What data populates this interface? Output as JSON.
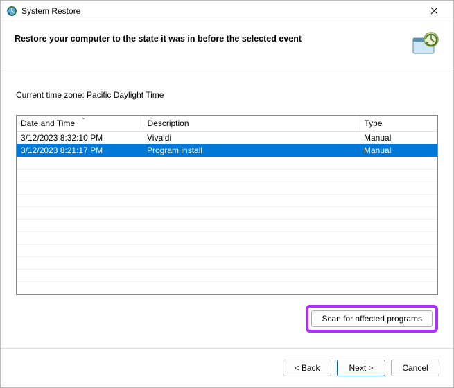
{
  "title": "System Restore",
  "heading": "Restore your computer to the state it was in before the selected event",
  "timezone_label": "Current time zone: Pacific Daylight Time",
  "columns": {
    "date": "Date and Time",
    "desc": "Description",
    "type": "Type"
  },
  "rows": [
    {
      "date": "3/12/2023 8:32:10 PM",
      "desc": "Vivaldi",
      "type": "Manual",
      "selected": false
    },
    {
      "date": "3/12/2023 8:21:17 PM",
      "desc": "Program install",
      "type": "Manual",
      "selected": true
    }
  ],
  "scan_button": "Scan for affected programs",
  "nav": {
    "back": "< Back",
    "next": "Next >",
    "cancel": "Cancel"
  }
}
